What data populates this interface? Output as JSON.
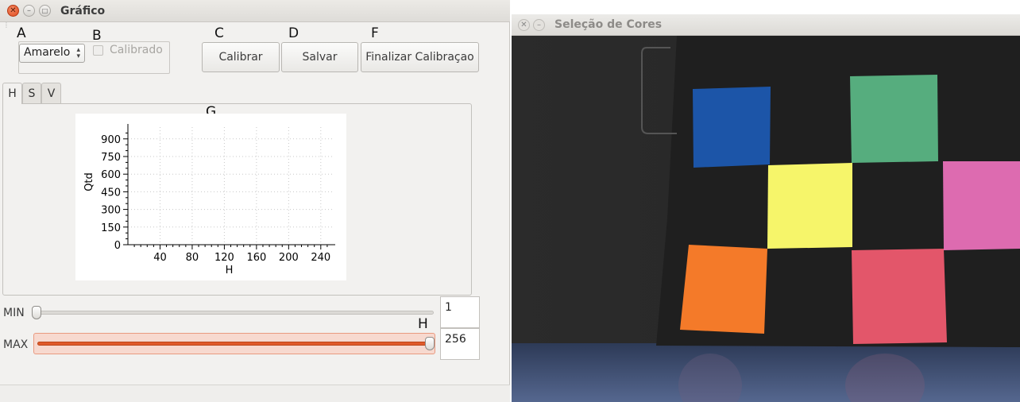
{
  "left_window": {
    "title": "Gráfico",
    "markers": {
      "A": "A",
      "B": "B",
      "C": "C",
      "D": "D",
      "F": "F",
      "G": "G",
      "H": "H"
    },
    "color_select": {
      "value": "Amarelo"
    },
    "calibrado_checkbox": {
      "label": "Calibrado",
      "checked": false,
      "enabled": false
    },
    "buttons": {
      "calibrar": "Calibrar",
      "salvar": "Salvar",
      "finalizar": "Finalizar Calibraçao"
    },
    "tabs": [
      {
        "label": "H",
        "active": true
      },
      {
        "label": "S",
        "active": false
      },
      {
        "label": "V",
        "active": false
      }
    ],
    "sliders": {
      "min": {
        "label": "MIN",
        "value": "1"
      },
      "max": {
        "label": "MAX",
        "value": "256"
      }
    }
  },
  "right_window": {
    "title": "Seleção de Cores",
    "icons": [
      "close-icon",
      "minimize-icon"
    ]
  },
  "chart_data": {
    "type": "line",
    "title": "",
    "xlabel": "H",
    "ylabel": "Qtd",
    "xlim": [
      0,
      256
    ],
    "ylim": [
      0,
      1000
    ],
    "x_ticks": [
      "40",
      "80",
      "120",
      "160",
      "200",
      "240"
    ],
    "y_ticks": [
      "0",
      "150",
      "300",
      "450",
      "600",
      "750",
      "900"
    ],
    "grid": true,
    "series": []
  }
}
